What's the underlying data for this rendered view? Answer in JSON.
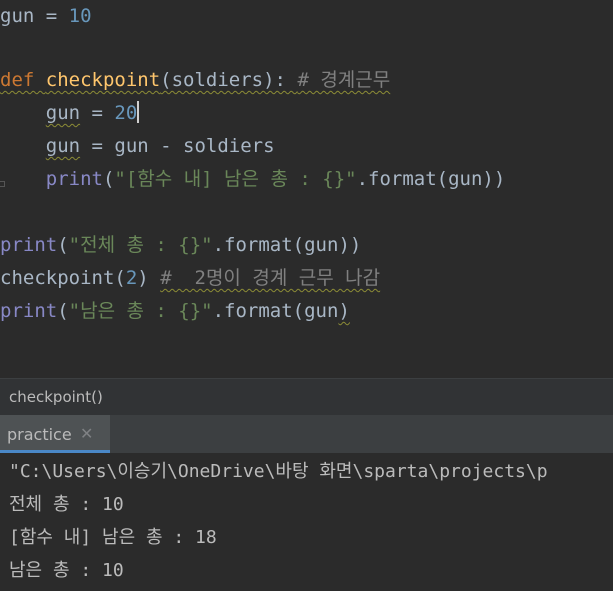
{
  "editor": {
    "l1": {
      "var": "gun",
      "eq": " = ",
      "num": "10"
    },
    "l2": {
      "kw": "def ",
      "fn": "checkpoint",
      "args": "(soldiers): ",
      "cmt": "# 경계근무"
    },
    "l3": {
      "indent": "    ",
      "var": "gun",
      "eq": " = ",
      "num": "20"
    },
    "l4": {
      "indent": "    ",
      "var": "gun",
      "rest": " = gun - soldiers"
    },
    "l5": {
      "indent": "    ",
      "builtin": "print",
      "open": "(",
      "str": "\"[함수 내] 남은 총 : {}\"",
      "rest": ".format(gun))"
    },
    "l6": {
      "builtin": "print",
      "open": "(",
      "str": "\"전체 총 : {}\"",
      "rest": ".format(gun))"
    },
    "l7": {
      "fn": "checkpoint",
      "open": "(",
      "num": "2",
      "close": ") ",
      "cmt": "#  2명이 경계 근무 나감"
    },
    "l8": {
      "builtin": "print",
      "open": "(",
      "str": "\"남은 총 : {}\"",
      "mid": ".format(gun",
      "close": ")"
    }
  },
  "breadcrumb": {
    "label": "checkpoint()"
  },
  "run_panel": {
    "tab_label": "practice",
    "close_glyph": "✕",
    "output": [
      "\"C:\\Users\\이승기\\OneDrive\\바탕 화면\\sparta\\projects\\p",
      "전체 총 : 10",
      "[함수 내] 남은 총 : 18",
      "남은 총 : 10"
    ]
  }
}
